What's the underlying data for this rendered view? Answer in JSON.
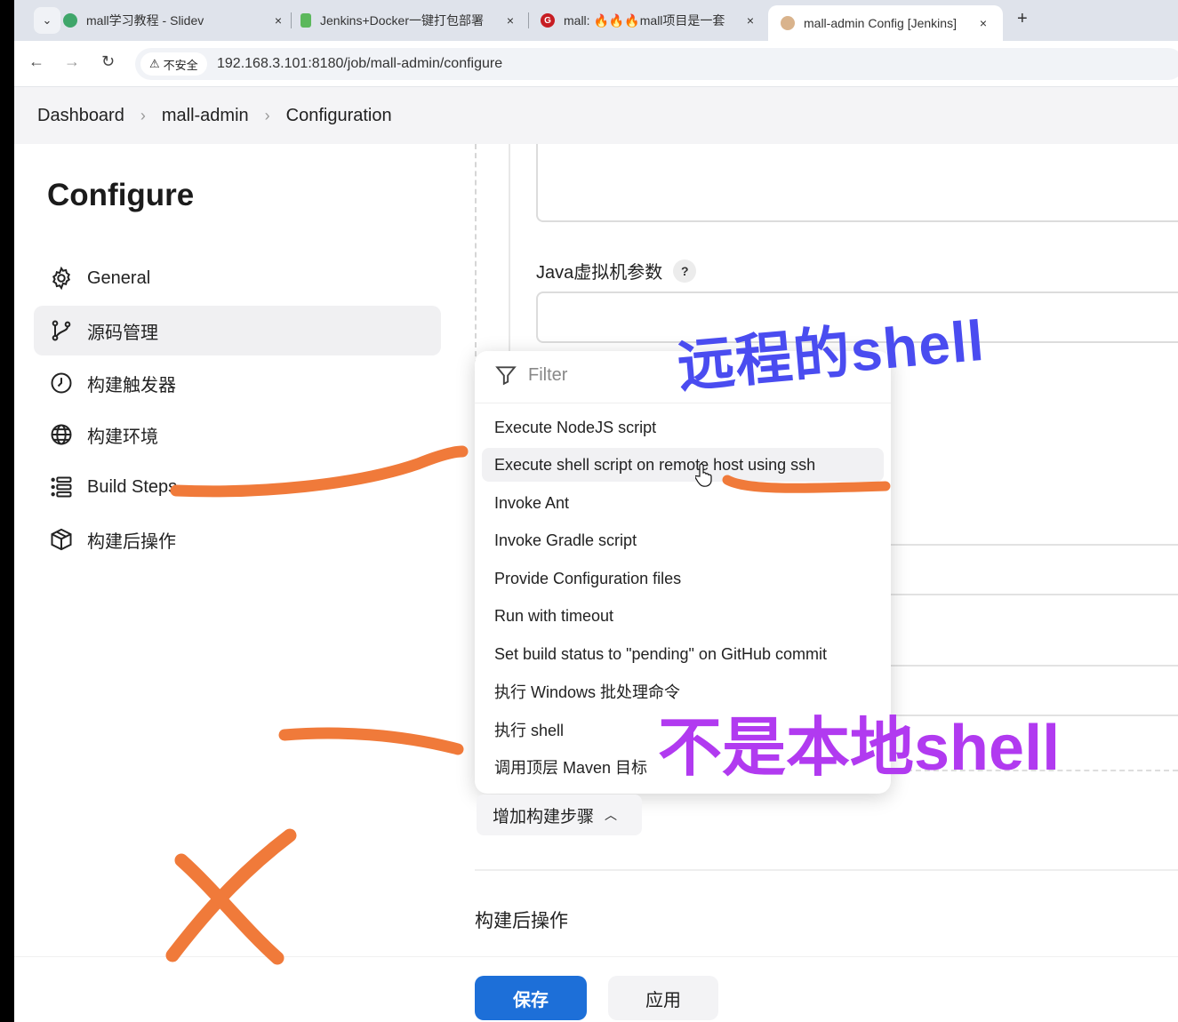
{
  "browser": {
    "tabs": [
      {
        "label": "mall学习教程 - Slidev",
        "close": "×"
      },
      {
        "label": "Jenkins+Docker一键打包部署",
        "close": "×"
      },
      {
        "label": "mall: 🔥🔥🔥mall项目是一套",
        "close": "×"
      },
      {
        "label": "mall-admin Config [Jenkins]",
        "close": "×"
      }
    ],
    "new_tab": "+",
    "security_label": "不安全",
    "url": "192.168.3.101:8180/job/mall-admin/configure"
  },
  "breadcrumb": {
    "items": [
      "Dashboard",
      "mall-admin",
      "Configuration"
    ],
    "separator": "›"
  },
  "sidebar": {
    "title": "Configure",
    "items": [
      {
        "label": "General",
        "icon": "gear-icon"
      },
      {
        "label": "源码管理",
        "icon": "branch-icon"
      },
      {
        "label": "构建触发器",
        "icon": "clock-icon"
      },
      {
        "label": "构建环境",
        "icon": "globe-icon"
      },
      {
        "label": "Build Steps",
        "icon": "list-icon"
      },
      {
        "label": "构建后操作",
        "icon": "package-icon"
      }
    ]
  },
  "main": {
    "jvm_label": "Java虚拟机参数",
    "help": "?",
    "dropdown": {
      "filter_placeholder": "Filter",
      "items": [
        "Execute NodeJS script",
        "Execute shell script on remote host using ssh",
        "Invoke Ant",
        "Invoke Gradle script",
        "Provide Configuration files",
        "Run with timeout",
        "Set build status to \"pending\" on GitHub commit",
        "执行 Windows 批处理命令",
        "执行 shell",
        "调用顶层 Maven 目标"
      ]
    },
    "add_step_label": "增加构建步骤",
    "post_build_label": "构建后操作",
    "save_label": "保存",
    "apply_label": "应用"
  },
  "annotations": {
    "remote_shell": "远程的shell",
    "not_local_shell": "不是本地shell"
  },
  "colors": {
    "primary_button": "#1d6fd8",
    "annotation_orange": "#f07a3a",
    "annotation_blue": "#4a4cf0",
    "annotation_purple": "#b13af0"
  }
}
